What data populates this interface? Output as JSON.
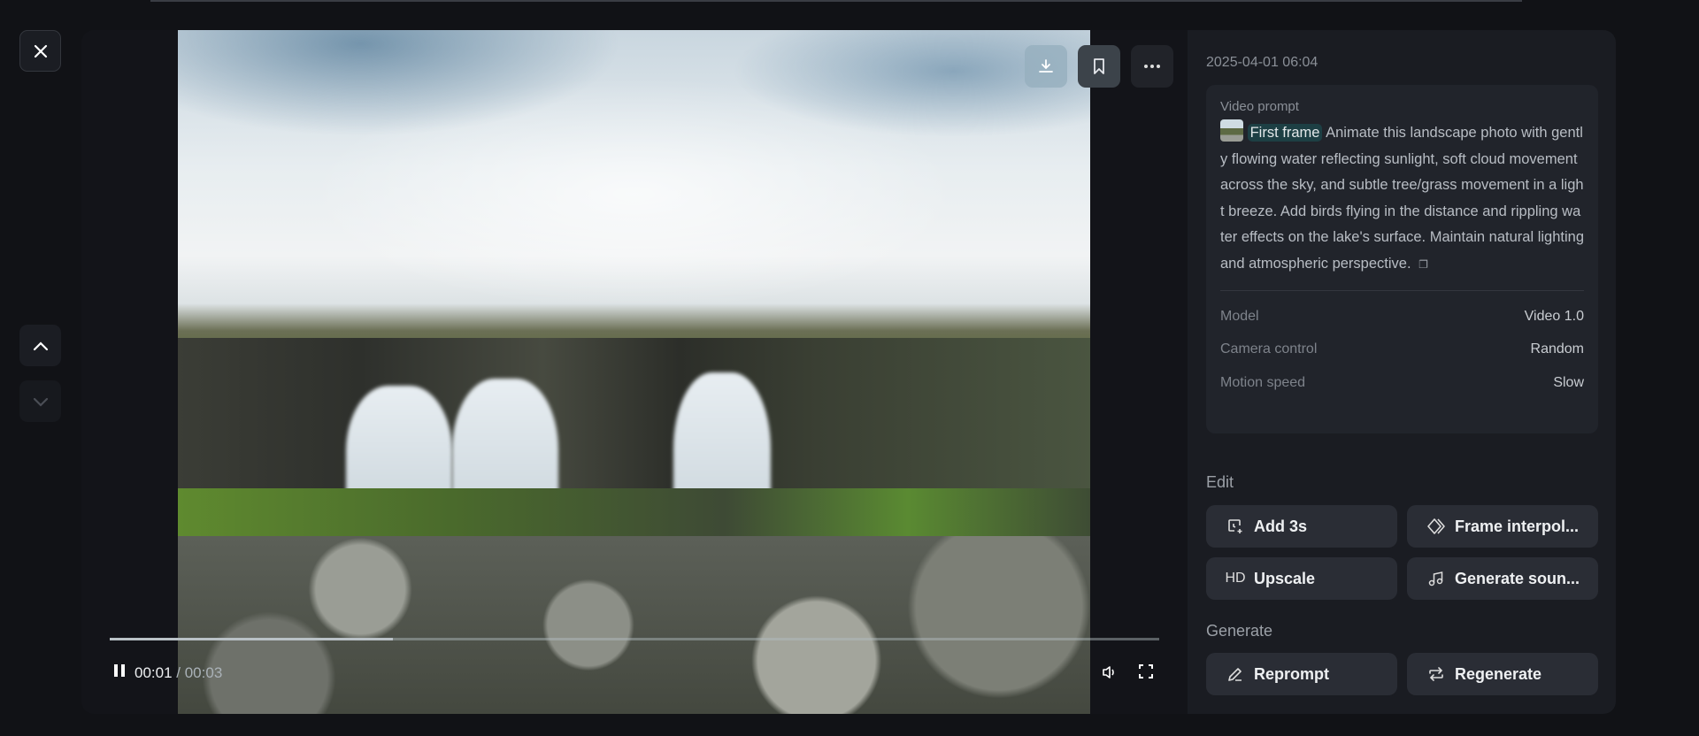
{
  "nav": {
    "close": "close",
    "prev": "previous",
    "next": "next"
  },
  "player": {
    "current_time": "00:01",
    "total_time": "/ 00:03",
    "progress_fraction": 0.27,
    "state": "playing"
  },
  "details": {
    "date": "2025-04-01 06:04",
    "prompt_label": "Video prompt",
    "first_frame_tag": "First frame",
    "prompt_text": "Animate this landscape photo with gently flowing water reflecting sunlight, soft cloud movement across the sky, and subtle tree/grass movement in a light breeze. Add birds flying in the distance and rippling water effects on the lake's surface. Maintain natural lighting and atmospheric perspective.",
    "settings": [
      {
        "key": "Model",
        "value": "Video 1.0"
      },
      {
        "key": "Camera control",
        "value": "Random"
      },
      {
        "key": "Motion speed",
        "value": "Slow"
      }
    ]
  },
  "edit": {
    "label": "Edit",
    "buttons": [
      {
        "label": "Add 3s",
        "icon": "clock-plus-icon"
      },
      {
        "label": "Frame interpol...",
        "icon": "diamond-icon"
      },
      {
        "label": "Upscale",
        "icon": "HD"
      },
      {
        "label": "Generate soun...",
        "icon": "music-note-icon"
      }
    ]
  },
  "generate": {
    "label": "Generate",
    "buttons": [
      {
        "label": "Reprompt",
        "icon": "pencil-icon"
      },
      {
        "label": "Regenerate",
        "icon": "repeat-icon"
      }
    ]
  }
}
